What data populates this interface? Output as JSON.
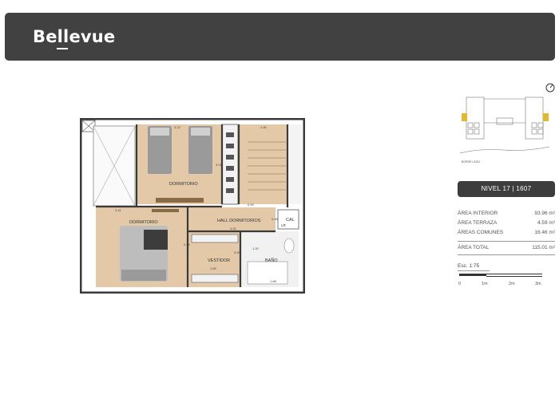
{
  "header": {
    "logo": "Bellevue"
  },
  "plan": {
    "rooms": {
      "dormitorio_1": "DORMITORIO",
      "dormitorio_2": "DORMITORIO",
      "hall": "HALL DORMITORIOS",
      "vestidor": "VESTIDOR",
      "bano": "BAÑO",
      "cal": "CAL",
      "lr": "LR"
    },
    "dimensions": {
      "d1_top": "3.22",
      "stair_top": "1.90",
      "d1_side": "3.01",
      "d2_top": "3.41",
      "hall_w": "3.31",
      "hall_small": "0.90",
      "hall_side": "0.90",
      "vest_w": "1.89",
      "vest_side": "0.90",
      "bano_w": "1.68",
      "d2_side": "2.95",
      "bano_side": "1.20"
    }
  },
  "keyplan": {
    "label": "BORDE LAGO"
  },
  "level": {
    "label": "NIVEL 17 | 1607"
  },
  "areas": {
    "rows": [
      {
        "label": "ÁREA INTERIOR",
        "value": "93.96 m²"
      },
      {
        "label": "ÁREA TERRAZA",
        "value": "4.59 m²"
      },
      {
        "label": "ÁREAS COMUNES",
        "value": "16.46 m²"
      }
    ],
    "total": {
      "label": "ÁREA TOTAL",
      "value": "115.01 m²"
    }
  },
  "scale": {
    "title": "Esc. 1:75",
    "ticks": [
      "0",
      "1m",
      "2m",
      "3m"
    ]
  }
}
